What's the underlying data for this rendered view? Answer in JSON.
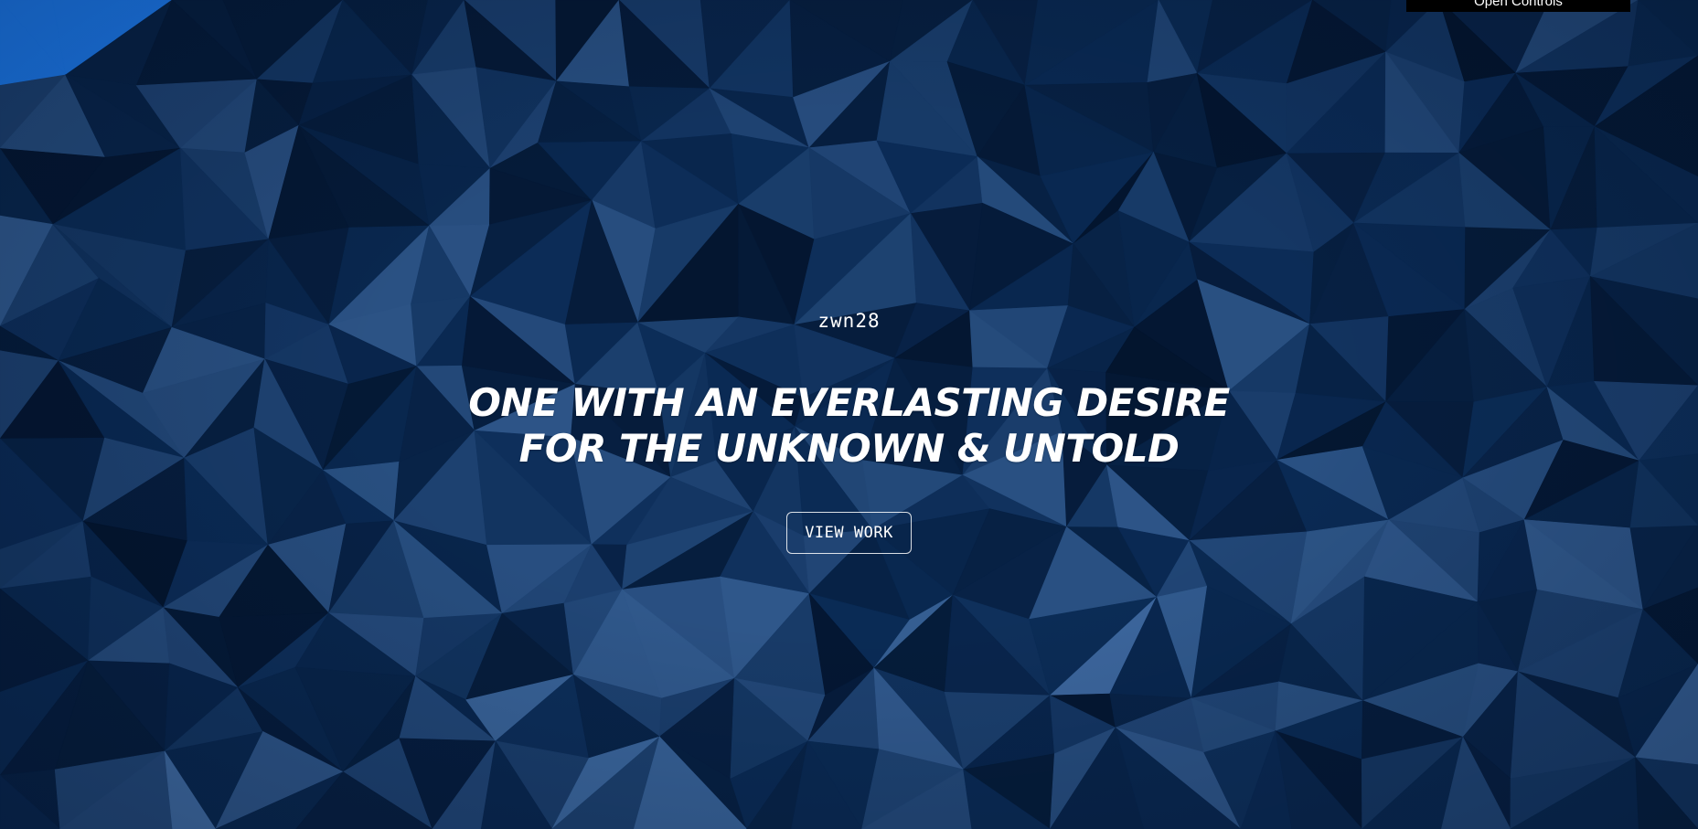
{
  "controls": {
    "toggle_label": "Open Controls"
  },
  "hero": {
    "handle": "zwn28",
    "headline_line1": "ONE WITH AN EVERLASTING DESIRE",
    "headline_line2": "FOR THE UNKNOWN & UNTOLD",
    "cta_label": "VIEW WORK"
  },
  "background": {
    "style": "low-poly",
    "base_color": "#06203f",
    "highlight_color": "#3a6aa3",
    "accent_color": "#1a73e0"
  }
}
